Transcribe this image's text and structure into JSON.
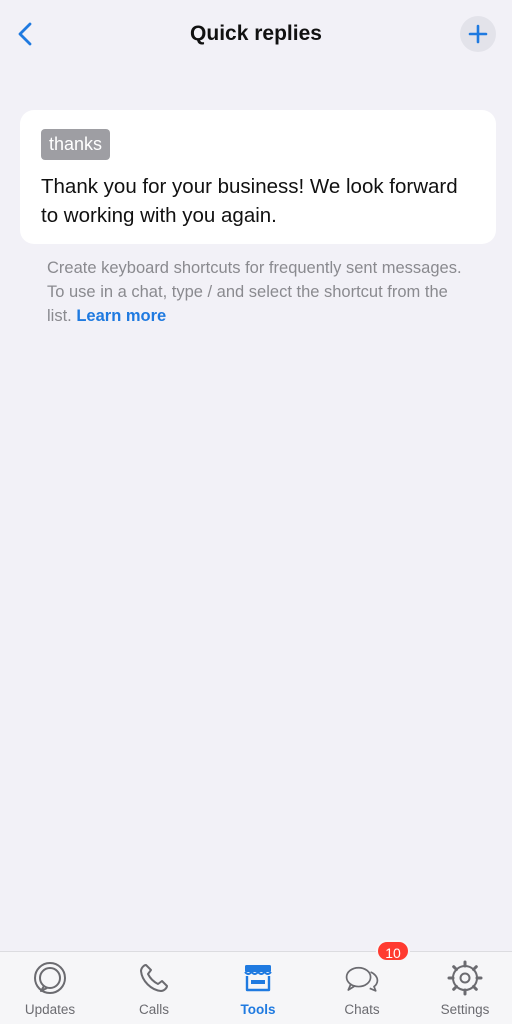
{
  "header": {
    "title": "Quick replies",
    "back_icon": "chevron-left-icon",
    "add_icon": "plus-icon"
  },
  "quick_replies": [
    {
      "shortcut": "thanks",
      "message": "Thank you for your business! We look forward to working with you again."
    }
  ],
  "help": {
    "text": "Create keyboard shortcuts for frequently sent messages. To use in a chat, type / and select the shortcut from the list.",
    "link_label": "Learn more"
  },
  "tabs": [
    {
      "label": "Updates",
      "icon": "updates-icon",
      "active": false
    },
    {
      "label": "Calls",
      "icon": "phone-icon",
      "active": false
    },
    {
      "label": "Tools",
      "icon": "storefront-icon",
      "active": true
    },
    {
      "label": "Chats",
      "icon": "chat-bubbles-icon",
      "active": false,
      "badge": "10"
    },
    {
      "label": "Settings",
      "icon": "gear-icon",
      "active": false
    }
  ],
  "colors": {
    "accent": "#1f7ae0",
    "background": "#f2f1f7",
    "badge": "#ff3b30",
    "tag": "#9e9ea3"
  }
}
